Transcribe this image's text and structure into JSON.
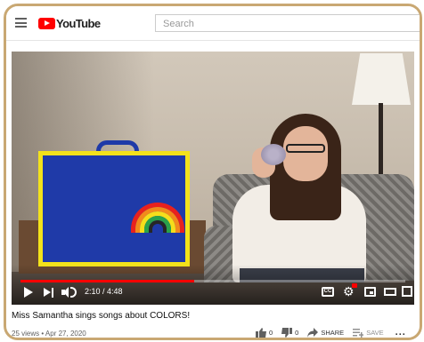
{
  "header": {
    "logo_text": "YouTube",
    "search_placeholder": "Search"
  },
  "player": {
    "time_display": "2:10 / 4:48",
    "progress_fraction": 0.451,
    "cc_label": "CC",
    "accent_color": "#ff0000"
  },
  "video": {
    "title": "Miss Samantha sings songs about COLORS!",
    "meta": "25 views • Apr 27, 2020",
    "likes": "0",
    "dislikes": "0",
    "share_label": "SHARE",
    "save_label": "SAVE",
    "more_label": "..."
  },
  "icons": [
    "menu-icon",
    "youtube-logo",
    "play-icon",
    "next-icon",
    "volume-icon",
    "captions-icon",
    "settings-icon",
    "miniplayer-icon",
    "theater-icon",
    "fullscreen-icon",
    "like-icon",
    "dislike-icon",
    "share-icon",
    "save-icon",
    "more-icon"
  ]
}
